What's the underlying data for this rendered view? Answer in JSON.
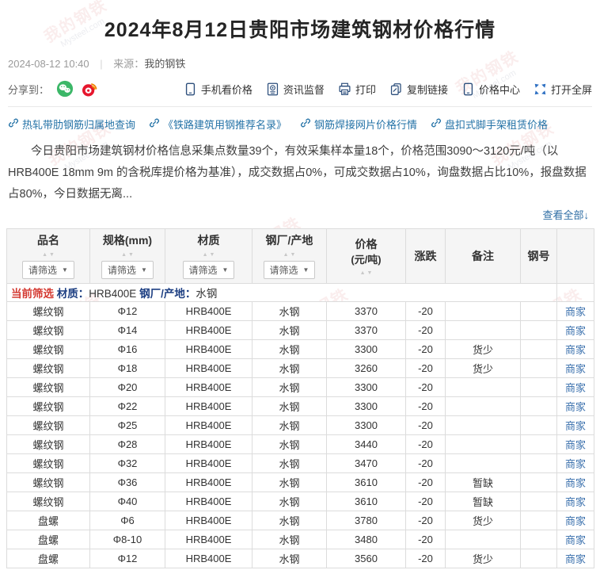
{
  "page": {
    "title": "2024年8月12日贵阳市场建筑钢材价格行情",
    "date": "2024-08-12 10:40",
    "source_label": "来源：",
    "source": "我的钢铁"
  },
  "share": {
    "label": "分享到：",
    "icons": [
      "wechat-icon",
      "weibo-icon"
    ]
  },
  "toolbar": {
    "items": [
      {
        "name": "phone-price",
        "icon": "mobile-icon",
        "label": "手机看价格"
      },
      {
        "name": "info-monitor",
        "icon": "monitor-badge-icon",
        "label": "资讯监督"
      },
      {
        "name": "print",
        "icon": "printer-icon",
        "label": "打印"
      },
      {
        "name": "copy-link",
        "icon": "copy-link-icon",
        "label": "复制链接"
      },
      {
        "name": "price-center",
        "icon": "mobile-icon",
        "label": "价格中心"
      },
      {
        "name": "fullscreen",
        "icon": "fullscreen-icon",
        "label": "打开全屏"
      }
    ]
  },
  "quick_links": [
    "热轧带肋钢筋归属地查询",
    "《铁路建筑用钢推荐名录》",
    "钢筋焊接网片价格行情",
    "盘扣式脚手架租赁价格"
  ],
  "summary": "今日贵阳市场建筑钢材价格信息采集点数量39个，有效采集样本量18个，价格范围3090～3120元/吨（以HRB400E 18mm 9m 的含税库提价格为基准），成交数据占0%，可成交数据占10%，询盘数据占比10%，报盘数据占80%，今日数据无离...",
  "view_all": "查看全部↓",
  "table": {
    "filter_placeholder": "请筛选",
    "current_filter": {
      "prefix": "当前筛选",
      "material_label": "材质：",
      "material": "HRB400E",
      "mill_label": "钢厂/产地：",
      "mill": "水钢"
    },
    "columns": [
      {
        "label": "品名",
        "sortable": true,
        "filterable": true
      },
      {
        "label": "规格(mm)",
        "sortable": true,
        "filterable": true
      },
      {
        "label": "材质",
        "sortable": true,
        "filterable": true
      },
      {
        "label": "钢厂/产地",
        "sortable": true,
        "filterable": true
      },
      {
        "label": "价格",
        "sub": "(元/吨)",
        "sortable": true,
        "filterable": false
      },
      {
        "label": "涨跌",
        "sortable": false,
        "filterable": false
      },
      {
        "label": "备注",
        "sortable": false,
        "filterable": false
      },
      {
        "label": "钢号",
        "sortable": false,
        "filterable": false
      },
      {
        "label": "",
        "sortable": false,
        "filterable": false
      }
    ],
    "merchant_label": "商家",
    "rows": [
      {
        "name": "螺纹钢",
        "spec": "Φ12",
        "material": "HRB400E",
        "mill": "水钢",
        "price": "3370",
        "change": "-20",
        "remark": "",
        "steel_no": ""
      },
      {
        "name": "螺纹钢",
        "spec": "Φ14",
        "material": "HRB400E",
        "mill": "水钢",
        "price": "3370",
        "change": "-20",
        "remark": "",
        "steel_no": ""
      },
      {
        "name": "螺纹钢",
        "spec": "Φ16",
        "material": "HRB400E",
        "mill": "水钢",
        "price": "3300",
        "change": "-20",
        "remark": "货少",
        "steel_no": ""
      },
      {
        "name": "螺纹钢",
        "spec": "Φ18",
        "material": "HRB400E",
        "mill": "水钢",
        "price": "3260",
        "change": "-20",
        "remark": "货少",
        "steel_no": ""
      },
      {
        "name": "螺纹钢",
        "spec": "Φ20",
        "material": "HRB400E",
        "mill": "水钢",
        "price": "3300",
        "change": "-20",
        "remark": "",
        "steel_no": ""
      },
      {
        "name": "螺纹钢",
        "spec": "Φ22",
        "material": "HRB400E",
        "mill": "水钢",
        "price": "3300",
        "change": "-20",
        "remark": "",
        "steel_no": ""
      },
      {
        "name": "螺纹钢",
        "spec": "Φ25",
        "material": "HRB400E",
        "mill": "水钢",
        "price": "3300",
        "change": "-20",
        "remark": "",
        "steel_no": ""
      },
      {
        "name": "螺纹钢",
        "spec": "Φ28",
        "material": "HRB400E",
        "mill": "水钢",
        "price": "3440",
        "change": "-20",
        "remark": "",
        "steel_no": ""
      },
      {
        "name": "螺纹钢",
        "spec": "Φ32",
        "material": "HRB400E",
        "mill": "水钢",
        "price": "3470",
        "change": "-20",
        "remark": "",
        "steel_no": ""
      },
      {
        "name": "螺纹钢",
        "spec": "Φ36",
        "material": "HRB400E",
        "mill": "水钢",
        "price": "3610",
        "change": "-20",
        "remark": "暂缺",
        "steel_no": ""
      },
      {
        "name": "螺纹钢",
        "spec": "Φ40",
        "material": "HRB400E",
        "mill": "水钢",
        "price": "3610",
        "change": "-20",
        "remark": "暂缺",
        "steel_no": ""
      },
      {
        "name": "盘螺",
        "spec": "Φ6",
        "material": "HRB400E",
        "mill": "水钢",
        "price": "3780",
        "change": "-20",
        "remark": "货少",
        "steel_no": ""
      },
      {
        "name": "盘螺",
        "spec": "Φ8-10",
        "material": "HRB400E",
        "mill": "水钢",
        "price": "3480",
        "change": "-20",
        "remark": "",
        "steel_no": ""
      },
      {
        "name": "盘螺",
        "spec": "Φ12",
        "material": "HRB400E",
        "mill": "水钢",
        "price": "3560",
        "change": "-20",
        "remark": "货少",
        "steel_no": ""
      }
    ]
  }
}
